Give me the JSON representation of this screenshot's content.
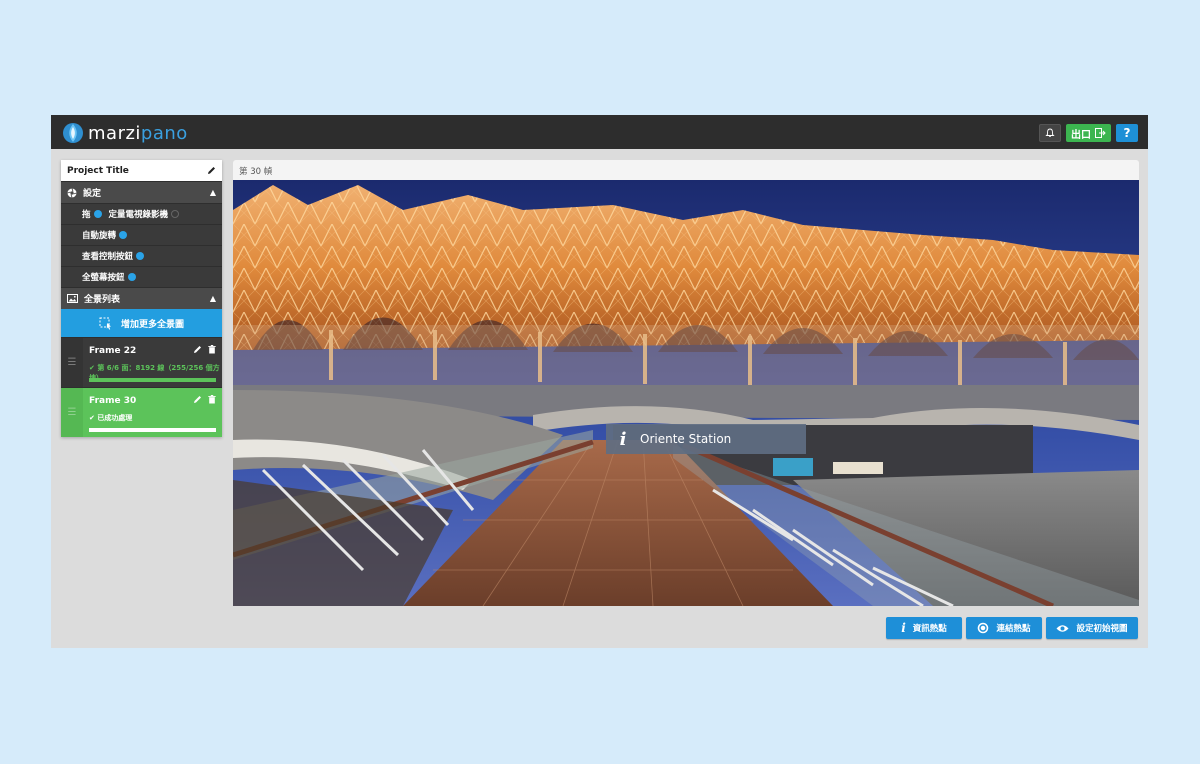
{
  "app": {
    "logo_marzi": "marzi",
    "logo_pano": "pano",
    "exit_label": "出口",
    "help_label": "?"
  },
  "sidebar": {
    "project_title": "Project Title",
    "settings_label": "設定",
    "settings_items": [
      {
        "label": "拖",
        "label2": "定量電視錄影機",
        "state": "on"
      },
      {
        "label": "自動旋轉",
        "state": "on"
      },
      {
        "label": "查看控制按鈕",
        "state": "on"
      },
      {
        "label": "全螢幕按鈕",
        "state": "on"
      }
    ],
    "pano_list_label": "全景列表",
    "add_more_label": "增加更多全景圖",
    "panoramas": [
      {
        "name": "Frame 22",
        "status": "第 6/6 面：8192 線（255/256 個方塊）",
        "progress": 1.0
      },
      {
        "name": "Frame 30",
        "status": "已成功處理",
        "progress": 1.0
      }
    ]
  },
  "main": {
    "frame_label": "第 30 幀",
    "hotspot_title": "Oriente Station"
  },
  "actions": {
    "info_hotspot": "資訊熱點",
    "link_hotspot": "連結熱點",
    "set_initial_view": "設定初始視圖"
  },
  "colors": {
    "accent": "#239ee0",
    "success": "#5cc35a",
    "topbar": "#2d2d2d"
  }
}
